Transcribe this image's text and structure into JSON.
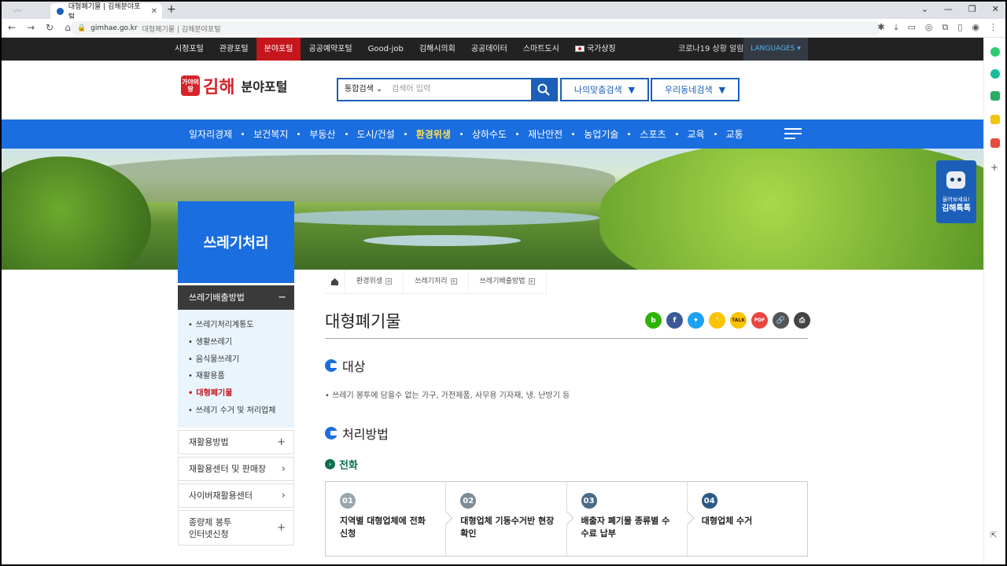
{
  "browser": {
    "tab_title": "대형폐기물 | 김해분야포털",
    "url_host": "gimhae.go.kr",
    "url_path": "대형폐기물 | 김해분야포털"
  },
  "topnav": {
    "links": [
      "시정포털",
      "관광포털",
      "분야포털",
      "공공예약포털",
      "Good-job",
      "김해시의회",
      "공공데이터",
      "스마트도시",
      "국가상징"
    ],
    "active_index": 2,
    "covid": "코로나19 상황 알림",
    "languages": "LANGUAGES"
  },
  "header": {
    "logo_mark": "가야의 땅",
    "logo_city": "김해",
    "logo_portal": "분야포털",
    "search_select": "통합검색",
    "search_placeholder": "검색어 입력",
    "btn_custom": "나의맞춤검색",
    "btn_town": "우리동네검색"
  },
  "mainmenu": {
    "items": [
      "일자리경제",
      "보건복지",
      "부동산",
      "도시/건설",
      "환경위생",
      "상하수도",
      "재난안전",
      "농업기술",
      "스포츠",
      "교육",
      "교통"
    ],
    "active_index": 4
  },
  "robot": {
    "line1": "물어보세요!",
    "line2": "김해톡톡"
  },
  "sidebar": {
    "title": "쓰레기처리",
    "section": "쓰레기배출방법",
    "sub_items": [
      "쓰레기처리계통도",
      "생활쓰레기",
      "음식물쓰레기",
      "재활용품",
      "대형폐기물",
      "쓰레기 수거 및 처리업체"
    ],
    "active_sub": 4,
    "items": [
      {
        "label": "재활용방법",
        "sign": "+"
      },
      {
        "label": "재활용센터 및 판매장",
        "sign": "›"
      },
      {
        "label": "사이버재활용센터",
        "sign": "›"
      },
      {
        "label": "종량제 봉투\n인터넷신청",
        "sign": "+"
      }
    ]
  },
  "breadcrumb": [
    "환경위생",
    "쓰레기처리",
    "쓰레기배출방법"
  ],
  "content": {
    "title": "대형폐기물",
    "share_icons": [
      "blog",
      "facebook",
      "twitter",
      "kakaostory",
      "kakaotalk",
      "pdf",
      "link",
      "print"
    ],
    "section1": "대상",
    "section1_text": "쓰레기 봉투에 담을수 없는 가구, 가전제품, 사무용 기자재, 냉. 난방기 등",
    "section2": "처리방법",
    "sub_heading": "전화",
    "steps": [
      {
        "num": "01",
        "text": "지역별 대형업체에 전화 신청",
        "color": "#9aa5ad"
      },
      {
        "num": "02",
        "text": "대형업체 기동수거반 현장 확인",
        "color": "#7e8a93"
      },
      {
        "num": "03",
        "text": "배출자 폐기물 종류별 수수료 납부",
        "color": "#4a6a85"
      },
      {
        "num": "04",
        "text": "대형업체 수거",
        "color": "#2c5a86"
      }
    ]
  },
  "colors": {
    "brand_blue": "#1b6ee0",
    "accent_red": "#c4161c",
    "active_yellow": "#ffe14d"
  }
}
